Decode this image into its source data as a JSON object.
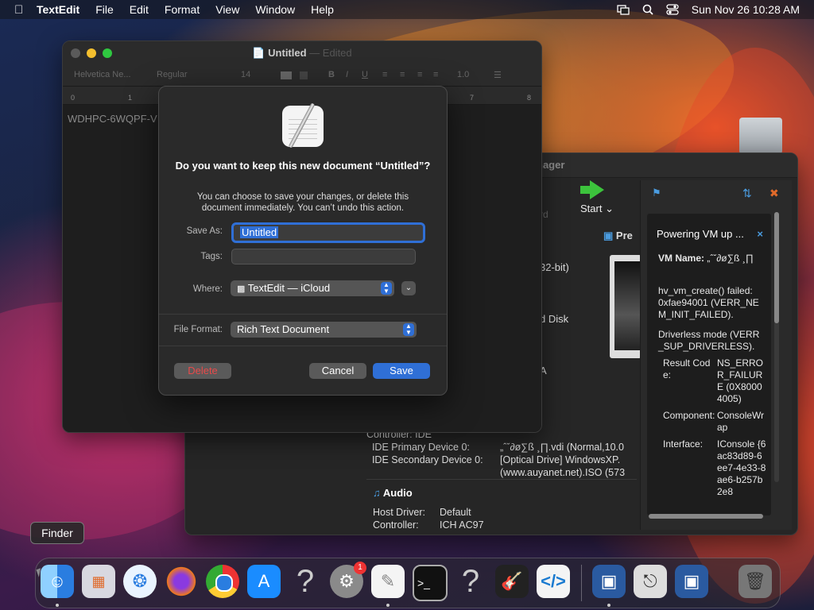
{
  "menubar": {
    "app": "TextEdit",
    "items": [
      "File",
      "Edit",
      "Format",
      "View",
      "Window",
      "Help"
    ],
    "datetime": "Sun Nov 26  10:28 AM",
    "icons": [
      "apple-icon",
      "screen-mirror-icon",
      "search-icon",
      "control-center-icon"
    ]
  },
  "textedit": {
    "title": "Untitled",
    "title_status": "— Edited",
    "toolbar": {
      "font": "Helvetica Ne...",
      "style": "Regular",
      "size": "14",
      "spacing": "1.0"
    },
    "ruler": [
      "0",
      "1",
      "7",
      "8"
    ],
    "doc_text": "WDHPC-6WQPF-V"
  },
  "save_sheet": {
    "heading": "Do you want to keep this new document “Untitled”?",
    "message": "You can choose to save your changes, or delete this document immediately. You can’t undo this action.",
    "save_as_label": "Save As:",
    "save_as_value": "Untitled",
    "tags_label": "Tags:",
    "tags_value": "",
    "where_label": "Where:",
    "where_value": "TextEdit — iCloud",
    "format_label": "File Format:",
    "format_value": "Rich Text Document",
    "delete": "Delete",
    "cancel": "Cancel",
    "save": "Save"
  },
  "vbox": {
    "title_fragment": "nager",
    "start": "Start",
    "ghost": "rd",
    "preview": "Pre",
    "frag_bits": "32-bit)",
    "frag_disk": "d Disk",
    "frag_a": "A",
    "details": [
      {
        "k": "Controller: IDE",
        "v": ""
      },
      {
        "k": "  IDE Primary Device 0:",
        "v": "„ˆˇ∂ø∑ß ¸∏.vdi (Normal,10.0"
      },
      {
        "k": "  IDE Secondary Device 0:",
        "v": "[Optical Drive] WindowsXP."
      },
      {
        "k": "",
        "v": "(www.auyanet.net).ISO (573"
      }
    ],
    "audio_header": "Audio",
    "audio": [
      {
        "k": "Host Driver:",
        "v": "Default"
      },
      {
        "k": "Controller:",
        "v": "ICH AC97"
      }
    ],
    "notification": {
      "title": "Powering VM up ...",
      "vm_name_label": "VM Name:",
      "vm_name_value": "„ˆˇ∂ø∑ß ¸∏",
      "error1": "hv_vm_create() failed: 0xfae94001 (VERR_NEM_INIT_FAILED).",
      "error2": "Driverless mode (VERR_SUP_DRIVERLESS).",
      "result_code_label": "Result Code:",
      "result_code_value": "NS_ERROR_FAILURE (0X80004005)",
      "component_label": "Component:",
      "component_value": "ConsoleWrap",
      "interface_label": "Interface:",
      "interface_value": "IConsole {6ac83d89-6ee7-4e33-8ae6-b257b2e8"
    }
  },
  "dock": {
    "tooltip": "Finder",
    "badge": "1",
    "apps": [
      "finder-icon",
      "launchpad-icon",
      "safari-icon",
      "firefox-icon",
      "chrome-icon",
      "app-store-icon",
      "unknown-app-icon",
      "system-settings-icon",
      "textedit-icon",
      "terminal-icon",
      "unknown-app-icon",
      "garageband-icon",
      "vscode-icon",
      "virtualbox-icon",
      "network-icon",
      "virtualbox-icon",
      "trash-icon"
    ]
  }
}
